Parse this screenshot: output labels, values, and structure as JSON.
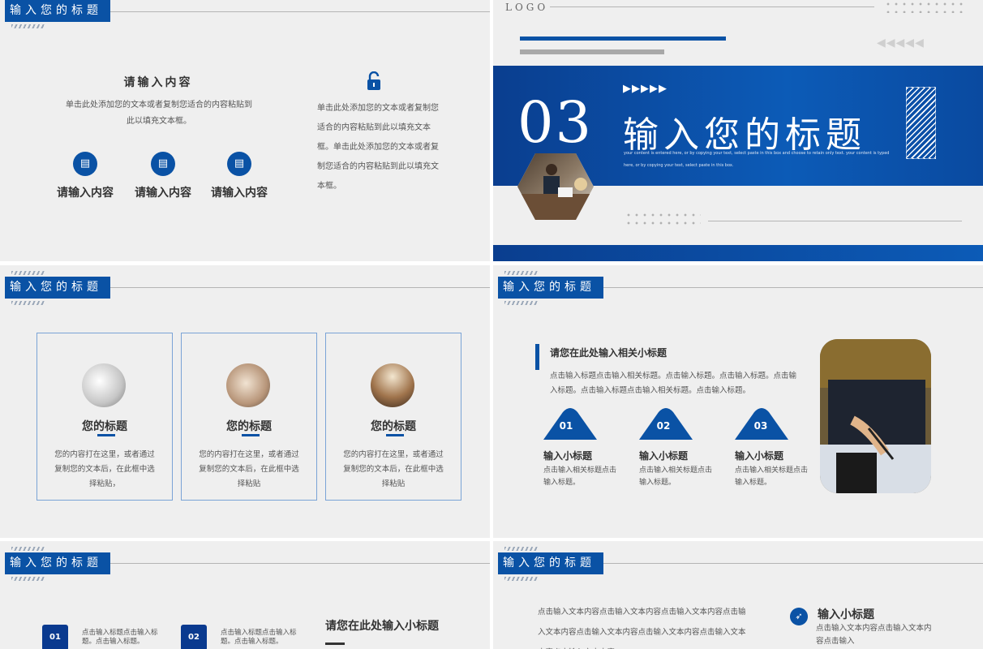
{
  "header_title": "输入您的标题",
  "slide1": {
    "title": "请输入内容",
    "body": "单击此处添加您的文本或者复制您适合的内容粘贴到此以填充文本框。",
    "items": [
      {
        "icon": "document-icon",
        "label": "请输入内容"
      },
      {
        "icon": "document-icon",
        "label": "请输入内容"
      },
      {
        "icon": "document-icon",
        "label": "请输入内容"
      }
    ],
    "paragraph": "单击此处添加您的文本或者复制您适合的内容粘贴到此以填充文本框。单击此处添加您的文本或者复制您适合的内容粘贴到此以填充文本框。"
  },
  "slide2": {
    "logo": "LOGO",
    "number": "03",
    "title": "输入您的标题",
    "subtitle": "your content is entered here, or by copying your text, select paste in this box and choose to retain only text. your content is typed here, or by copying your text, select paste in this box.",
    "arrows": "▶▶▶▶▶",
    "triangles": "◀◀◀◀◀",
    "accent_color": "#0a52a5"
  },
  "slide3": {
    "cards": [
      {
        "title": "您的标题",
        "body": "您的内容打在这里，或者通过复制您的文本后，在此框中选择粘贴，"
      },
      {
        "title": "您的标题",
        "body": "您的内容打在这里，或者通过复制您的文本后，在此框中选择粘贴"
      },
      {
        "title": "您的标题",
        "body": "您的内容打在这里，或者通过复制您的文本后，在此框中选择粘贴"
      }
    ]
  },
  "slide4": {
    "subtitle": "请您在此处输入相关小标题",
    "body": "点击输入标题点击输入相关标题。点击输入标题。点击输入标题。点击输入标题。点击输入标题点击输入相关标题。点击输入标题。",
    "items": [
      {
        "num": "01",
        "label": "输入小标题",
        "text": "点击输入相关标题点击输入标题。"
      },
      {
        "num": "02",
        "label": "输入小标题",
        "text": "点击输入相关标题点击输入标题。"
      },
      {
        "num": "03",
        "label": "输入小标题",
        "text": "点击输入相关标题点击输入标题。"
      }
    ]
  },
  "slide5": {
    "items": [
      {
        "num": "01",
        "text": "点击输入标题点击输入标题。点击输入标题。"
      },
      {
        "num": "02",
        "text": "点击输入标题点击输入标题。点击输入标题。"
      }
    ],
    "subtitle": "请您在此处输入小标题"
  },
  "slide6": {
    "body": "点击输入文本内容点击输入文本内容点击输入文本内容点击输入文本内容点击输入文本内容点击输入文本内容点击输入文本内容点击输入文本内容",
    "title": "输入小标题",
    "text": "点击输入文本内容点击输入文本内容点击输入"
  }
}
